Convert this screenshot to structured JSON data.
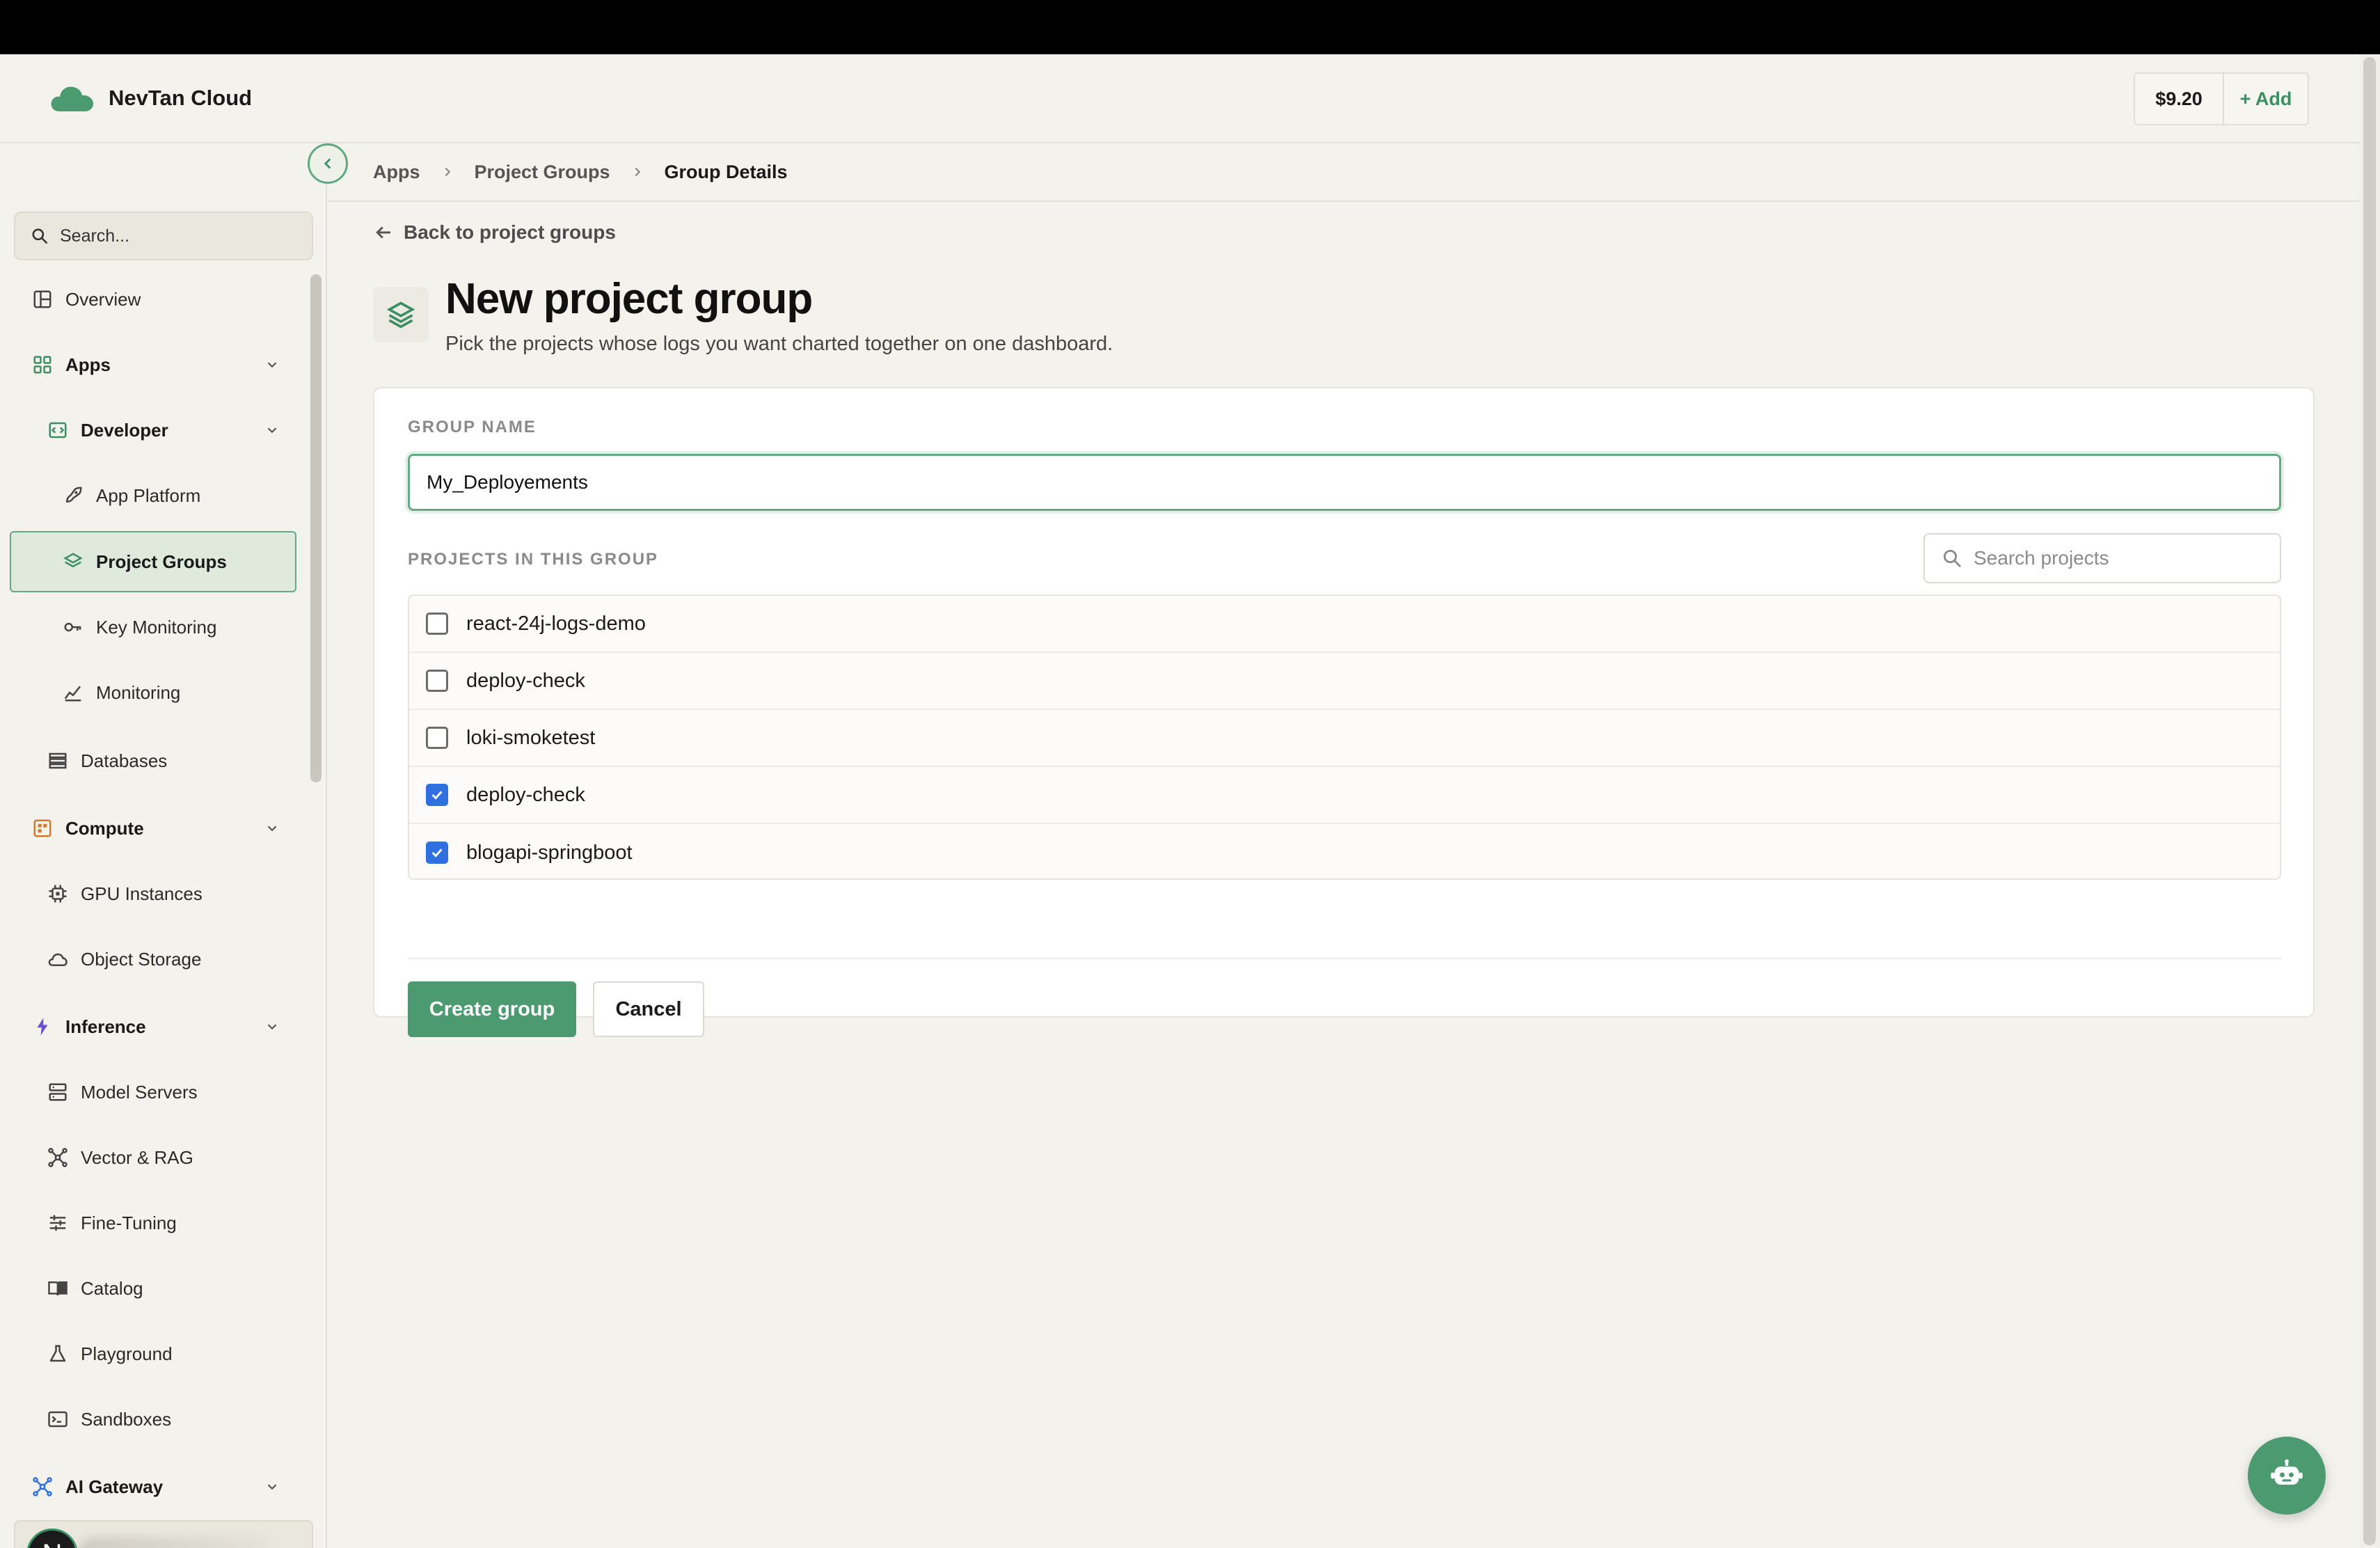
{
  "brand": {
    "name": "NevTan Cloud"
  },
  "credits": {
    "amount": "$9.20",
    "add_label": "+ Add"
  },
  "sidebar": {
    "search_placeholder": "Search...",
    "items": [
      {
        "label": "Overview"
      },
      {
        "label": "Apps"
      },
      {
        "label": "Developer"
      },
      {
        "label": "App Platform"
      },
      {
        "label": "Project Groups"
      },
      {
        "label": "Key Monitoring"
      },
      {
        "label": "Monitoring"
      },
      {
        "label": "Databases"
      },
      {
        "label": "Compute"
      },
      {
        "label": "GPU Instances"
      },
      {
        "label": "Object Storage"
      },
      {
        "label": "Inference"
      },
      {
        "label": "Model Servers"
      },
      {
        "label": "Vector & RAG"
      },
      {
        "label": "Fine-Tuning"
      },
      {
        "label": "Catalog"
      },
      {
        "label": "Playground"
      },
      {
        "label": "Sandboxes"
      },
      {
        "label": "AI Gateway"
      }
    ],
    "user": {
      "initial": "N"
    }
  },
  "breadcrumb": [
    "Apps",
    "Project Groups",
    "Group Details"
  ],
  "back_link": "Back to project groups",
  "page": {
    "title": "New project group",
    "subtitle": "Pick the projects whose logs you want charted together on one dashboard."
  },
  "form": {
    "group_name_label": "GROUP NAME",
    "group_name_value": "My_Deployements",
    "projects_label": "PROJECTS IN THIS GROUP",
    "search_placeholder": "Search projects",
    "projects": [
      {
        "name": "react-24j-logs-demo",
        "checked": false
      },
      {
        "name": "deploy-check",
        "checked": false
      },
      {
        "name": "loki-smoketest",
        "checked": false
      },
      {
        "name": "deploy-check",
        "checked": true
      },
      {
        "name": "blogapi-springboot",
        "checked": true
      }
    ],
    "create_label": "Create group",
    "cancel_label": "Cancel"
  },
  "colors": {
    "accent": "#4c9a70",
    "checkbox": "#2f6fe0",
    "background": "#f4f2ec"
  }
}
